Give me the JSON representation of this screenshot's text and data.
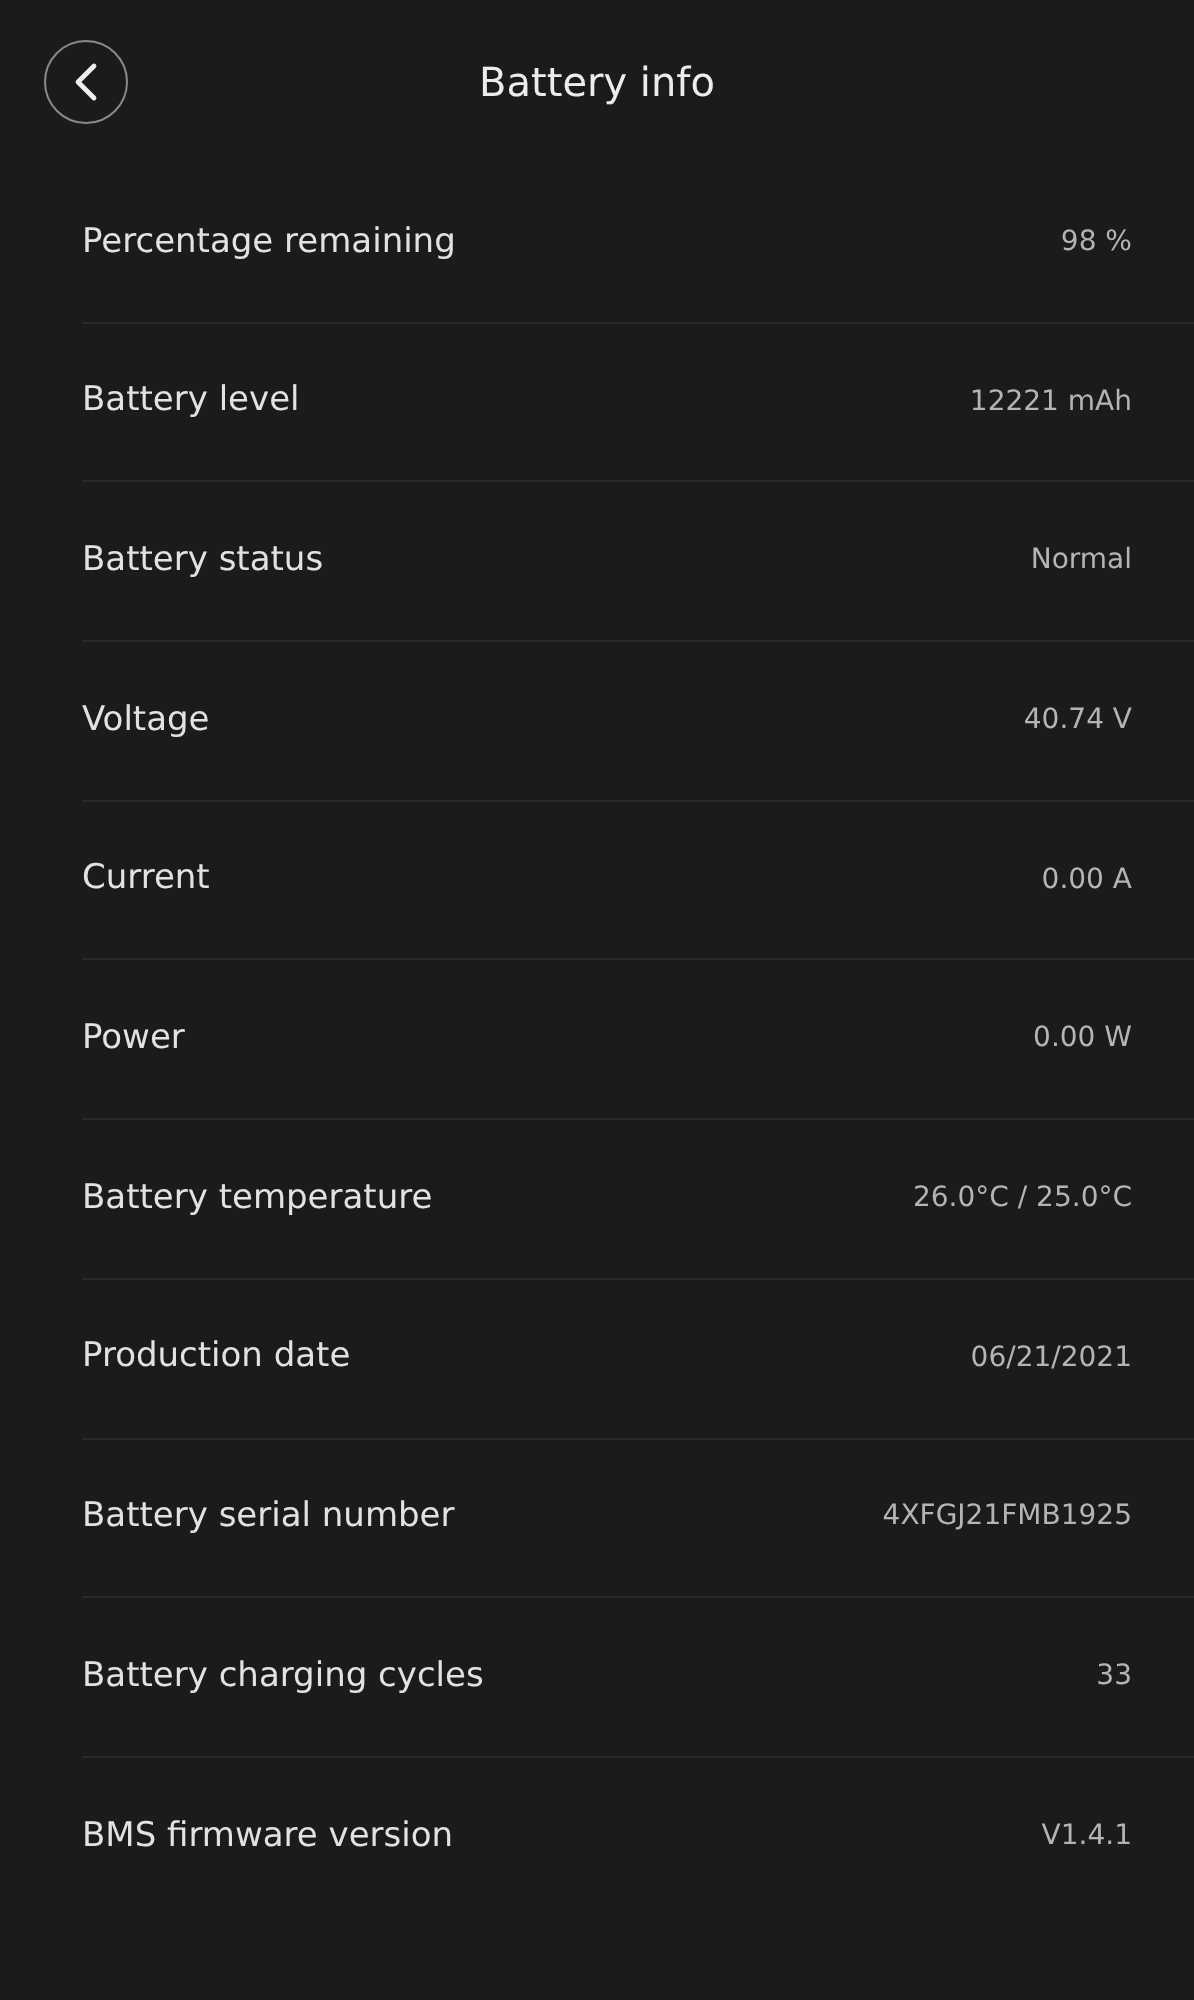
{
  "header": {
    "title": "Battery info"
  },
  "rows": [
    {
      "label": "Percentage remaining",
      "value": "98 %"
    },
    {
      "label": "Battery level",
      "value": "12221 mAh"
    },
    {
      "label": "Battery status",
      "value": "Normal"
    },
    {
      "label": "Voltage",
      "value": "40.74 V"
    },
    {
      "label": "Current",
      "value": "0.00 A"
    },
    {
      "label": "Power",
      "value": "0.00 W"
    },
    {
      "label": "Battery temperature",
      "value": "26.0°C / 25.0°C"
    },
    {
      "label": "Production date",
      "value": "06/21/2021"
    },
    {
      "label": "Battery serial number",
      "value": "4XFGJ21FMB1925"
    },
    {
      "label": "Battery charging cycles",
      "value": "33"
    },
    {
      "label": "BMS firmware version",
      "value": "V1.4.1"
    }
  ]
}
